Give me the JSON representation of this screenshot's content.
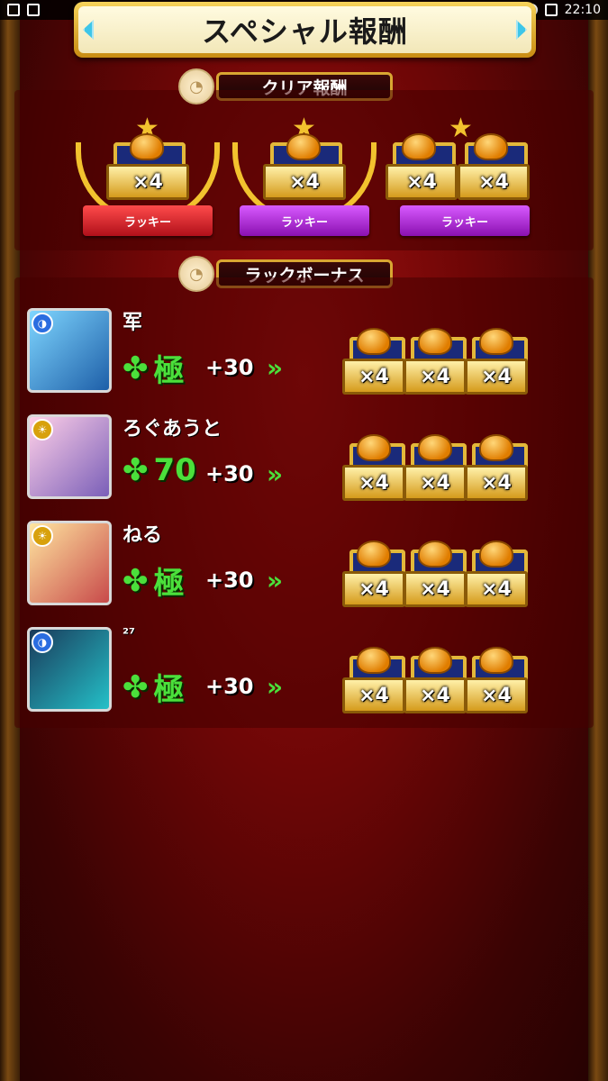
{
  "status_bar": {
    "time": "22:10"
  },
  "header": {
    "title": "スペシャル報酬"
  },
  "clear_section": {
    "label": "クリア報酬",
    "awards": [
      {
        "multiplier": "×4",
        "ribbon": "ラッキー",
        "ribbon_color": "#c8182a",
        "chest_count": 1
      },
      {
        "multiplier": "×4",
        "ribbon": "ラッキー",
        "ribbon_color": "#a51fd6",
        "chest_count": 1
      },
      {
        "multiplier": "×4",
        "multiplier2": "×4",
        "ribbon": "ラッキー",
        "ribbon_color": "#a51fd6",
        "chest_count": 2
      }
    ]
  },
  "luck_section": {
    "label": "ラックボーナス",
    "rows": [
      {
        "name": "军",
        "luck": "極",
        "bonus": "+30",
        "arrows": "»",
        "chests": [
          "×4",
          "×4",
          "×4"
        ]
      },
      {
        "name": "ろぐあうと",
        "luck": "70",
        "bonus": "+30",
        "arrows": "»",
        "chests": [
          "×4",
          "×4",
          "×4"
        ]
      },
      {
        "name": "ねる",
        "luck": "極",
        "bonus": "+30",
        "arrows": "»",
        "chests": [
          "×4",
          "×4",
          "×4"
        ]
      },
      {
        "name": "²⁷",
        "luck": "極",
        "bonus": "+30",
        "arrows": "»",
        "chests": [
          "×4",
          "×4",
          "×4"
        ]
      }
    ]
  },
  "colors": {
    "gold": "#f2c22e",
    "luck_green": "#4be03b",
    "background_red": "#a01010"
  },
  "icons": [
    "clover-icon",
    "treasure-chest-icon",
    "laurel-icon",
    "star-icon"
  ]
}
